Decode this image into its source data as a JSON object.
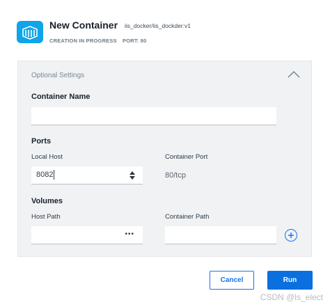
{
  "header": {
    "title": "New Container",
    "image_name": "iis_docker/iis_dockder:v1",
    "status": "CREATION IN PROGRESS",
    "port_info": "PORT: 80",
    "icon": "docker-container-icon",
    "icon_color": "#0ea5e9"
  },
  "optional_settings": {
    "label": "Optional Settings",
    "collapse_icon": "chevron-up-icon",
    "container_name": {
      "label": "Container Name",
      "value": ""
    },
    "ports": {
      "label": "Ports",
      "local_host_label": "Local Host",
      "local_host_value": "8082",
      "container_port_label": "Container Port",
      "container_port_value": "80/tcp"
    },
    "volumes": {
      "label": "Volumes",
      "host_path_label": "Host Path",
      "host_path_value": "",
      "browse_label": "•••",
      "container_path_label": "Container Path",
      "container_path_value": "",
      "add_icon": "plus-circle-icon"
    }
  },
  "actions": {
    "cancel_label": "Cancel",
    "run_label": "Run"
  },
  "watermark": "CSDN @ls_elect",
  "colors": {
    "accent": "#1a73e8",
    "panel_bg": "#f0f2f4"
  }
}
